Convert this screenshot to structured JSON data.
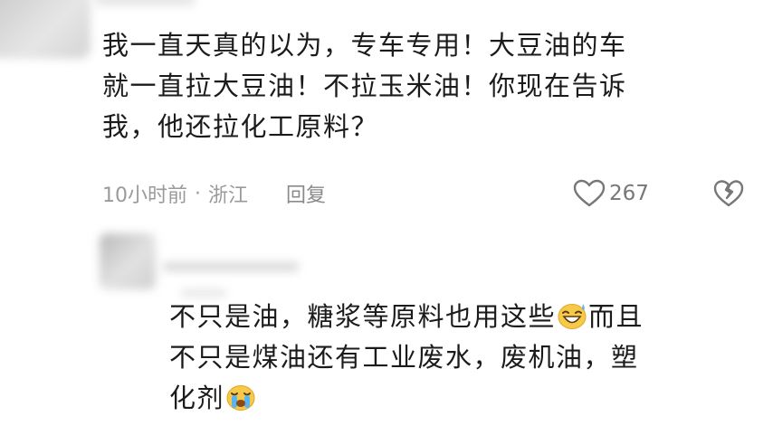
{
  "main_comment": {
    "lines": [
      "我一直天真的以为，专车专用！大豆油的车",
      "就一直拉大豆油！不拉玉米油！你现在告诉",
      "我，他还拉化工原料？"
    ],
    "time": "10小时前",
    "separator": "·",
    "region": "浙江",
    "reply_label": "回复",
    "like_count": "267"
  },
  "reply_comment": {
    "line1_part1": "不只是油，糖浆等原料也用这些",
    "line1_part2": "而且",
    "line2": "不只是煤油还有工业废水，废机油，塑",
    "line3": "化剂"
  },
  "icons": {
    "like": "heart-outline-icon",
    "dislike": "broken-heart-icon",
    "emoji_1": "grinning-sweat-emoji",
    "emoji_2": "loudly-crying-emoji"
  },
  "colors": {
    "text": "#1b1b1b",
    "meta": "#9a9a9a",
    "icon": "#777777"
  }
}
